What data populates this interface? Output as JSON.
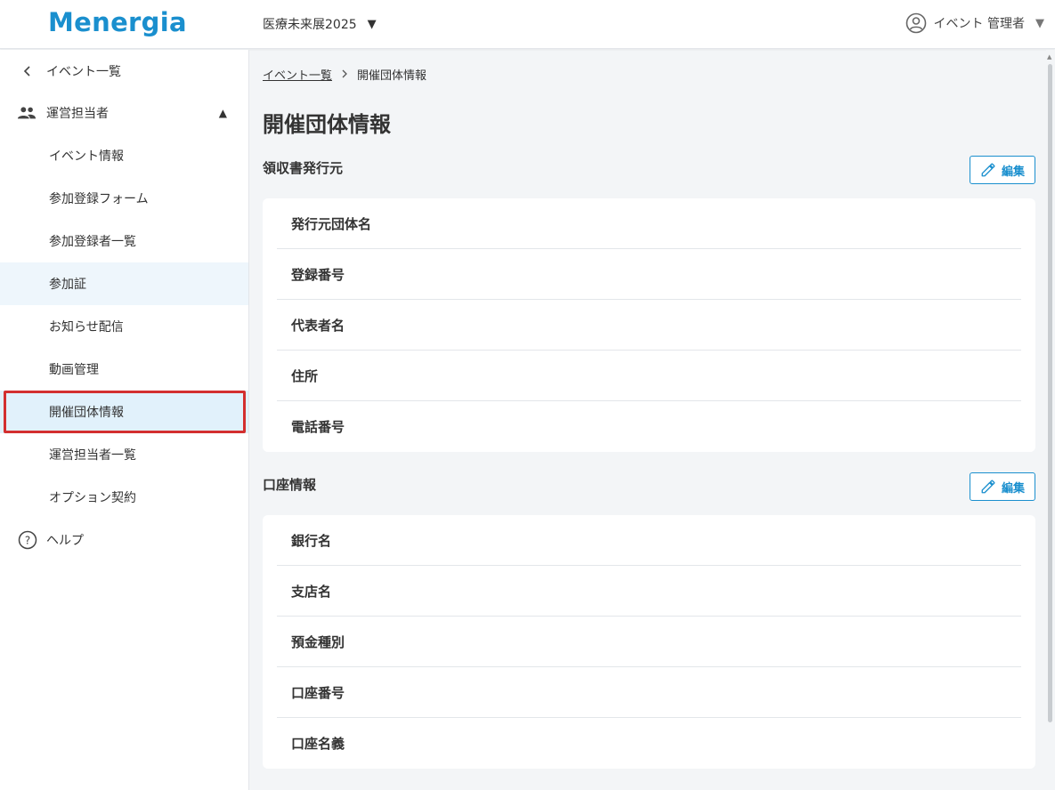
{
  "header": {
    "logo": "Menergia",
    "event_name": "医療未来展2025",
    "user_name": "イベント 管理者"
  },
  "sidebar": {
    "back_label": "イベント一覧",
    "group_label": "運営担当者",
    "items": [
      {
        "label": "イベント情報"
      },
      {
        "label": "参加登録フォーム"
      },
      {
        "label": "参加登録者一覧"
      },
      {
        "label": "参加証"
      },
      {
        "label": "お知らせ配信"
      },
      {
        "label": "動画管理"
      },
      {
        "label": "開催団体情報"
      },
      {
        "label": "運営担当者一覧"
      },
      {
        "label": "オプション契約"
      }
    ],
    "help_label": "ヘルプ"
  },
  "breadcrumb": {
    "parent": "イベント一覧",
    "current": "開催団体情報"
  },
  "page_title": "開催団体情報",
  "edit_label": "編集",
  "sections": [
    {
      "title": "領収書発行元",
      "rows": [
        "発行元団体名",
        "登録番号",
        "代表者名",
        "住所",
        "電話番号"
      ]
    },
    {
      "title": "口座情報",
      "rows": [
        "銀行名",
        "支店名",
        "預金種別",
        "口座番号",
        "口座名義"
      ]
    }
  ],
  "colors": {
    "brand": "#1a8fce",
    "active_bg": "#e1f1fb",
    "highlight": "#d32f2f"
  }
}
